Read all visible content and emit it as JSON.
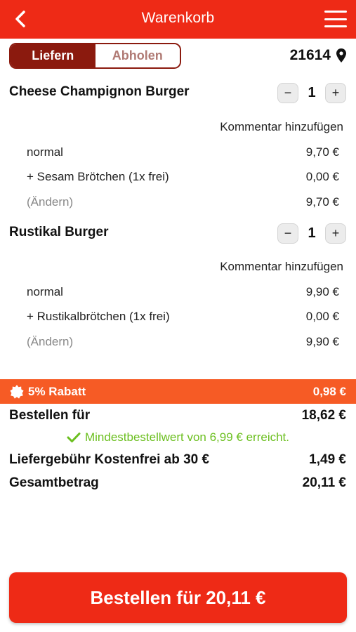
{
  "header": {
    "title": "Warenkorb"
  },
  "mode_toggle": {
    "deliver": "Liefern",
    "pickup": "Abholen",
    "active": "deliver"
  },
  "location": {
    "zip": "21614"
  },
  "items": [
    {
      "name": "Cheese Champignon Burger",
      "quantity": "1",
      "comment_label": "Kommentar hinzufügen",
      "lines": [
        {
          "label": "normal",
          "price": "9,70 €"
        },
        {
          "label": "+ Sesam Brötchen (1x frei)",
          "price": "0,00 €"
        },
        {
          "label": "(Ändern)",
          "price": "9,70 €"
        }
      ]
    },
    {
      "name": "Rustikal Burger",
      "quantity": "1",
      "comment_label": "Kommentar hinzufügen",
      "lines": [
        {
          "label": "normal",
          "price": "9,90 €"
        },
        {
          "label": "+ Rustikalbrötchen (1x frei)",
          "price": "0,00 €"
        },
        {
          "label": "(Ändern)",
          "price": "9,90 €"
        }
      ]
    }
  ],
  "discount": {
    "label": "5% Rabatt",
    "amount": "0,98 €"
  },
  "summary": {
    "order_for_label": "Bestellen für",
    "order_for_value": "18,62 €",
    "min_order_msg": "Mindestbestellwert von 6,99 € erreicht.",
    "delivery_label": "Liefergebühr Kostenfrei ab 30 €",
    "delivery_value": "1,49 €",
    "total_label": "Gesamtbetrag",
    "total_value": "20,11 €"
  },
  "order_button": {
    "label": "Bestellen für 20,11 €"
  },
  "colors": {
    "brand_red": "#ee2a16",
    "dark_red": "#8b1a0e",
    "discount_orange": "#f65b25",
    "success_green": "#6bbf1f"
  }
}
